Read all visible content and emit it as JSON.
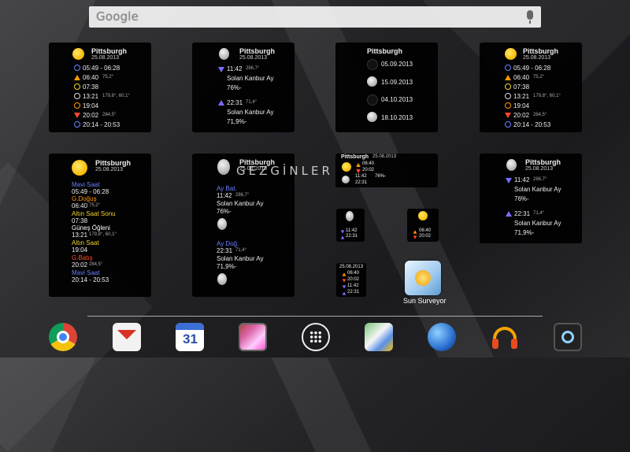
{
  "search": {
    "brand": "Google"
  },
  "watermark": "GEZGİNLER",
  "city": "Pittsburgh",
  "date": "25.08.2013",
  "w1": {
    "rows": [
      "05:49 - 06:28",
      "06:40",
      "75,2°",
      "07:38",
      "13:21",
      "179,8°, 60,1°",
      "19:04",
      "20:02",
      "284,5°",
      "20:14 - 20:53"
    ]
  },
  "w2": {
    "time1": "11:42",
    "az1": "286,7°",
    "phase": "Solan Kanbur Ay",
    "pct1": "76%-",
    "time2": "22:31",
    "az2": "71,4°",
    "pct2": "71,9%-"
  },
  "w3": {
    "dates": [
      "05.09.2013",
      "15.09.2013",
      "04.10.2013",
      "18.10.2013"
    ]
  },
  "w5": {
    "mavi": "Mavi Saat",
    "r1": "05:49 - 06:28",
    "gdogus": "G.Doğuş",
    "r2": "06:40",
    "r2b": "75,2°",
    "altinsonu": "Altın Saat Sonu",
    "r3": "07:38",
    "gunes": "Güneş Öğleni",
    "r4": "13:21",
    "r4b": "179,8°, 60,1°",
    "altin": "Altın Saat",
    "r5": "19:04",
    "gbatis": "G.Batış",
    "r6": "20:02",
    "r6b": "284,5°",
    "mavi2": "Mavi Saat",
    "r7": "20:14 - 20:53"
  },
  "w6": {
    "aybat": "Ay Bat.",
    "aydog": "Ay Doğ."
  },
  "w7": {
    "t1": "06:40",
    "t2": "20:02",
    "t3": "11:42",
    "t4": "76%-",
    "t5": "22:31"
  },
  "app": {
    "label": "Sun Surveyor"
  },
  "colors": {
    "accent_blue": "#6a7fff",
    "orange": "#ff9900",
    "red": "#ff4a2a",
    "yellow": "#f2d22a"
  }
}
